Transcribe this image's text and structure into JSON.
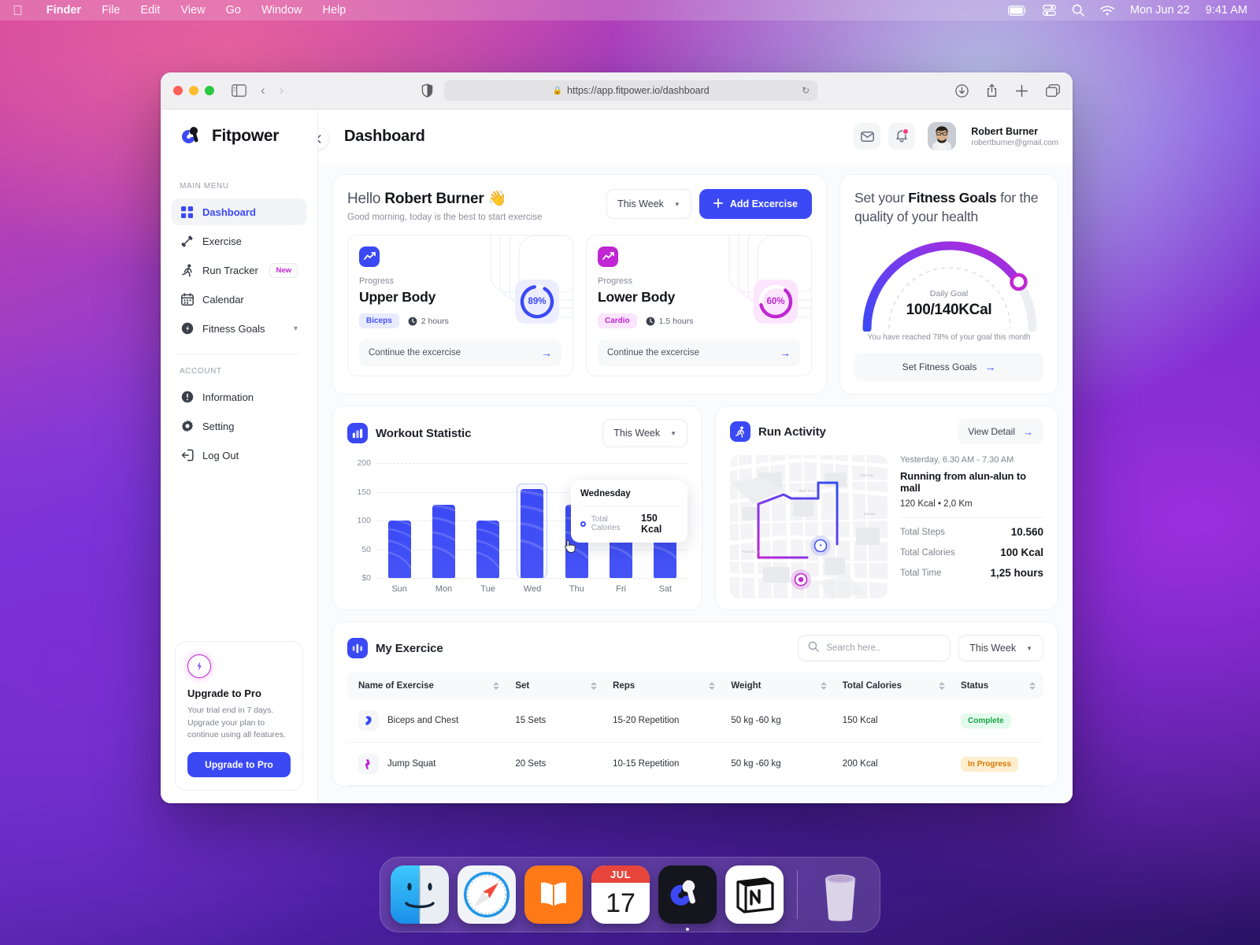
{
  "menubar": {
    "apple": "apple-logo",
    "items": [
      "Finder",
      "File",
      "Edit",
      "View",
      "Go",
      "Window",
      "Help"
    ],
    "status_icons": [
      "battery-icon",
      "control-center-icon",
      "search-icon",
      "wifi-icon"
    ],
    "date": "Mon Jun 22",
    "time": "9:41 AM"
  },
  "browser": {
    "url": "https://app.fitpower.io/dashboard",
    "lock": "lock-icon",
    "reload": "reload-icon",
    "icons": [
      "sidebar-icon",
      "back-icon",
      "forward-icon",
      "shield-icon",
      "download-icon",
      "share-icon",
      "new-tab-icon",
      "tabs-icon"
    ]
  },
  "sidebar": {
    "brand": "Fitpower",
    "main_label": "MAIN MENU",
    "account_label": "ACCOUNT",
    "main_items": [
      {
        "label": "Dashboard",
        "icon": "grid-icon",
        "active": true
      },
      {
        "label": "Exercise",
        "icon": "dumbbell-icon",
        "active": false
      },
      {
        "label": "Run Tracker",
        "icon": "runner-icon",
        "active": false,
        "badge": "New"
      },
      {
        "label": "Calendar",
        "icon": "calendar-icon",
        "active": false
      },
      {
        "label": "Fitness Goals",
        "icon": "target-icon",
        "active": false,
        "chevron": "chevron-down-icon"
      }
    ],
    "account_items": [
      {
        "label": "Information",
        "icon": "info-icon"
      },
      {
        "label": "Setting",
        "icon": "gear-icon"
      },
      {
        "label": "Log Out",
        "icon": "logout-icon"
      }
    ],
    "upgrade": {
      "icon": "bolt-icon",
      "title": "Upgrade to Pro",
      "text": "Your trial end in 7 days. Upgrade your plan to continue using all features.",
      "button": "Upgrade to Pro"
    }
  },
  "header": {
    "title": "Dashboard",
    "collapse": "chevron-left-icon",
    "mail_icon": "mail-icon",
    "bell_icon": "bell-icon",
    "user_name": "Robert Burner",
    "user_email": "robertburner@gmail.com"
  },
  "hello": {
    "greeting_prefix": "Hello ",
    "greeting_name": "Robert Burner",
    "wave": "👋",
    "subtitle": "Good morning, today is the best to start exercise",
    "period": "This Week",
    "add_button": "Add Excercise"
  },
  "progress_cards": [
    {
      "icon": "trend-icon",
      "label": "Progress",
      "name": "Upper Body",
      "tag": "Biceps",
      "duration": "2 hours",
      "clock": "clock-icon",
      "percent": "89%",
      "percent_value": 89,
      "cta": "Continue the excercise",
      "color": "#3b49f5"
    },
    {
      "icon": "trend-icon",
      "label": "Progress",
      "name": "Lower Body",
      "tag": "Cardio",
      "duration": "1.5 hours",
      "clock": "clock-icon",
      "percent": "60%",
      "percent_value": 60,
      "cta": "Continue the excercise",
      "color": "#c026d3"
    }
  ],
  "goals": {
    "title_a": "Set your ",
    "title_b": "Fitness Goals",
    "title_c": " for the quality of your health",
    "gauge_label": "Daily Goal",
    "gauge_value": "100/140KCal",
    "note": "You have reached 78% of your goal this month",
    "button": "Set Fitness Goals",
    "progress_pct": 78,
    "color_start": "#3b49f5",
    "color_end": "#c026d3"
  },
  "workout": {
    "icon": "bar-chart-icon",
    "title": "Workout Statistic",
    "period": "This Week",
    "tooltip": {
      "day": "Wednesday",
      "series": "Total Calories",
      "value": "150 Kcal"
    }
  },
  "chart_data": {
    "type": "bar",
    "title": "Workout Statistic",
    "categories": [
      "Sun",
      "Mon",
      "Tue",
      "Wed",
      "Thu",
      "Fri",
      "Sat"
    ],
    "values": [
      100,
      128,
      100,
      155,
      128,
      128,
      128
    ],
    "highlight_index": 3,
    "xlabel": "",
    "ylabel": "",
    "ylim": [
      0,
      200
    ],
    "yticks": [
      "$0",
      "50",
      "100",
      "150",
      "200"
    ],
    "ytick_values": [
      0,
      50,
      100,
      150,
      200
    ],
    "grid": true,
    "legend": "Total Calories",
    "unit": "Kcal",
    "series_color": "#3b49f5"
  },
  "run": {
    "icon": "runner-icon",
    "title": "Run Activity",
    "view_detail": "View Detail",
    "date": "Yesterday, 6.30 AM - 7.30 AM",
    "activity_title": "Running from alun-alun to mall",
    "activity_sub": "120 Kcal • 2,0 Km",
    "stats": [
      {
        "label": "Total Steps",
        "value": "10.560"
      },
      {
        "label": "Total Calories",
        "value": "100 Kcal"
      },
      {
        "label": "Total Time",
        "value": "1,25 hours"
      }
    ],
    "map_labels": [
      "2nd Ave",
      "3rd Ave",
      "Bath Street",
      "KK NAGAR"
    ]
  },
  "exercise_table": {
    "icon": "equalizer-icon",
    "title": "My Exercice",
    "search_placeholder": "Search here..",
    "search_value": "",
    "search_icon": "search-icon",
    "period": "This Week",
    "columns": [
      "Name of Exercise",
      "Set",
      "Reps",
      "Weight",
      "Total Calories",
      "Status"
    ],
    "rows": [
      {
        "icon": "biceps-icon",
        "name": "Biceps and Chest",
        "set": "15 Sets",
        "reps": "15-20 Repetition",
        "weight": "50 kg -60 kg",
        "calories": "150 Kcal",
        "status": "Complete",
        "status_type": "complete"
      },
      {
        "icon": "squat-icon",
        "name": "Jump Squat",
        "set": "20 Sets",
        "reps": "10-15 Repetition",
        "weight": "50 kg -60 kg",
        "calories": "200 Kcal",
        "status": "In Progress",
        "status_type": "progress"
      }
    ]
  },
  "dock": {
    "apps": [
      "finder-icon",
      "safari-icon",
      "books-icon",
      "calendar-icon",
      "fitpower-icon",
      "notion-icon"
    ],
    "calendar_month": "JUL",
    "calendar_day": "17",
    "trash": "trash-icon"
  }
}
